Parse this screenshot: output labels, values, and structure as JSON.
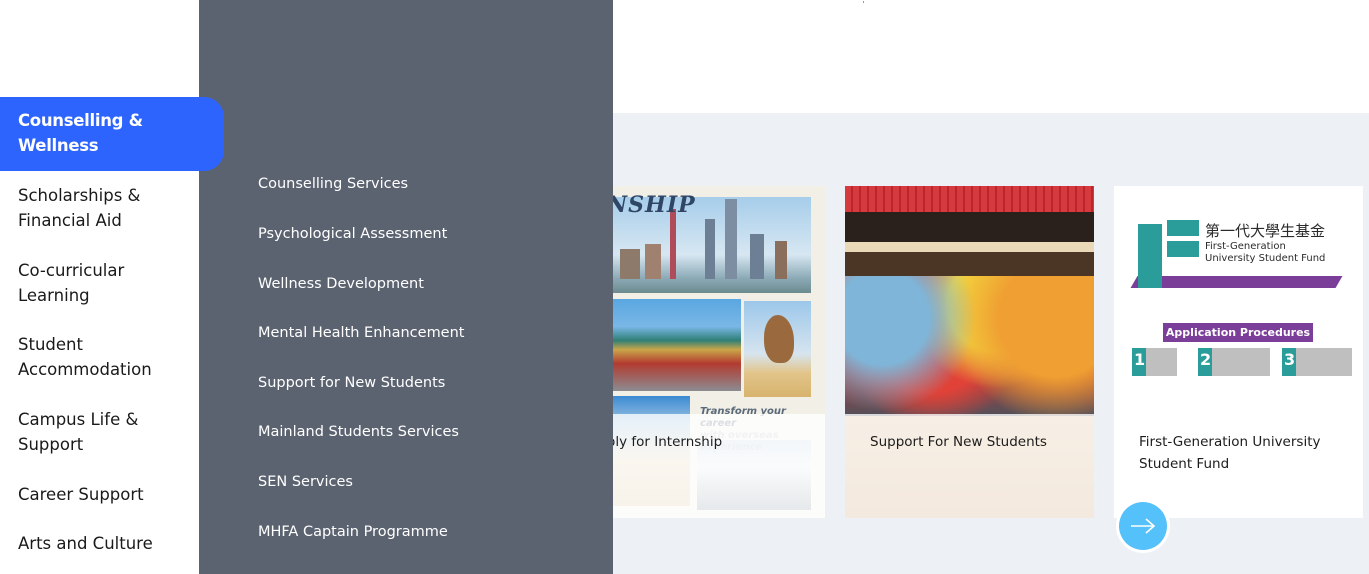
{
  "main_nav": {
    "active": "Counselling & Wellness",
    "items": [
      {
        "label": "Counselling & Wellness",
        "active": true
      },
      {
        "label": "Scholarships & Financial Aid"
      },
      {
        "label": "Co-curricular Learning"
      },
      {
        "label": "Student Accommodation"
      },
      {
        "label": "Campus Life & Support"
      },
      {
        "label": "Career Support"
      },
      {
        "label": "Arts and Culture"
      }
    ]
  },
  "sub_menu": {
    "items": [
      {
        "label": "Counselling Services"
      },
      {
        "label": "Psychological Assessment"
      },
      {
        "label": "Wellness Development"
      },
      {
        "label": "Mental Health Enhancement"
      },
      {
        "label": "Support for New Students"
      },
      {
        "label": "Mainland Students Services"
      },
      {
        "label": "SEN Services"
      },
      {
        "label": "MHFA Captain Programme"
      }
    ]
  },
  "cards": [
    {
      "label": "Apply for Internship",
      "image_title": "ERNSHIP",
      "image_tagline_1": "Transform your career",
      "image_tagline_2": "with overseas experience"
    },
    {
      "label": "Support For New Students"
    },
    {
      "label": "First-Generation University Student Fund",
      "image_title_cn": "第一代大學生基金",
      "image_title_en_1": "First-Generation",
      "image_title_en_2": "University Student Fund",
      "image_procedures": "Application Procedures",
      "steps": [
        "1",
        "2",
        "3"
      ]
    }
  ],
  "next_button": {
    "icon": "arrow-right-icon"
  },
  "colors": {
    "active_nav": "#2d64fe",
    "submenu_bg": "#5c6370",
    "band_bg": "#edf1f5",
    "next_button": "#55c1fa"
  }
}
